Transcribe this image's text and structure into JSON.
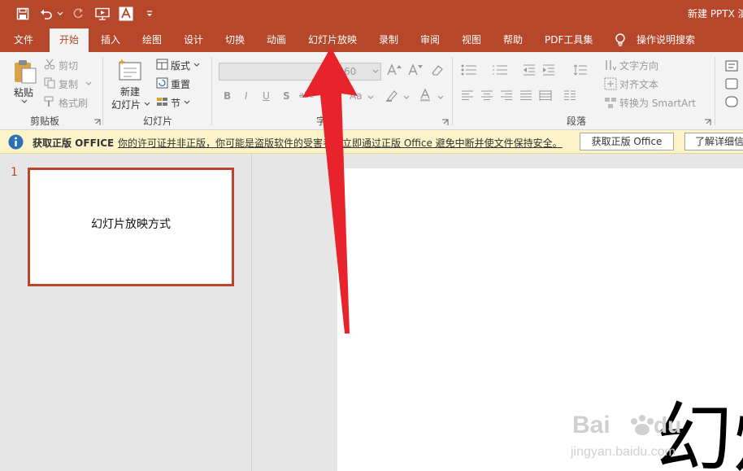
{
  "title_bar": {
    "document_title": "新建 PPTX 演"
  },
  "tabs": {
    "file": "文件",
    "home": "开始",
    "insert": "插入",
    "draw": "绘图",
    "design": "设计",
    "transitions": "切换",
    "animations": "动画",
    "slideshow": "幻灯片放映",
    "record": "录制",
    "review": "审阅",
    "view": "视图",
    "help": "帮助",
    "pdf_tools": "PDF工具集",
    "tell_me": "操作说明搜索"
  },
  "clipboard": {
    "paste": "粘贴",
    "cut": "剪切",
    "copy": "复制",
    "format_painter": "格式刷",
    "group_label": "剪贴板"
  },
  "slides_group": {
    "new_slide_line1": "新建",
    "new_slide_line2": "幻灯片",
    "layout": "版式",
    "reset": "重置",
    "section": "节",
    "group_label": "幻灯片"
  },
  "font_group": {
    "font_size": "60",
    "font_name": "",
    "group_label": "字",
    "bold": "B",
    "italic": "I",
    "underline": "U",
    "shadow": "S",
    "strike": "abc",
    "change_case": "Aa"
  },
  "paragraph_group": {
    "text_direction": "文字方向",
    "align_text": "对齐文本",
    "convert_smartart": "转换为 SmartArt",
    "group_label": "段落"
  },
  "message_bar": {
    "title": "获取正版 OFFICE",
    "text": "你的许可证并非正版，你可能是盗版软件的受害者。立即通过正版 Office 避免中断并使文件保持安全。",
    "button_get": "获取正版 Office",
    "button_learn": "了解详细信"
  },
  "thumbnails": [
    {
      "number": "1",
      "text": "幻灯片放映方式"
    }
  ],
  "slide": {
    "title_text": "幻灯"
  },
  "colors": {
    "accent": "#b7472a",
    "arrow": "#e8232b",
    "message_bar": "#fcf4c8"
  }
}
